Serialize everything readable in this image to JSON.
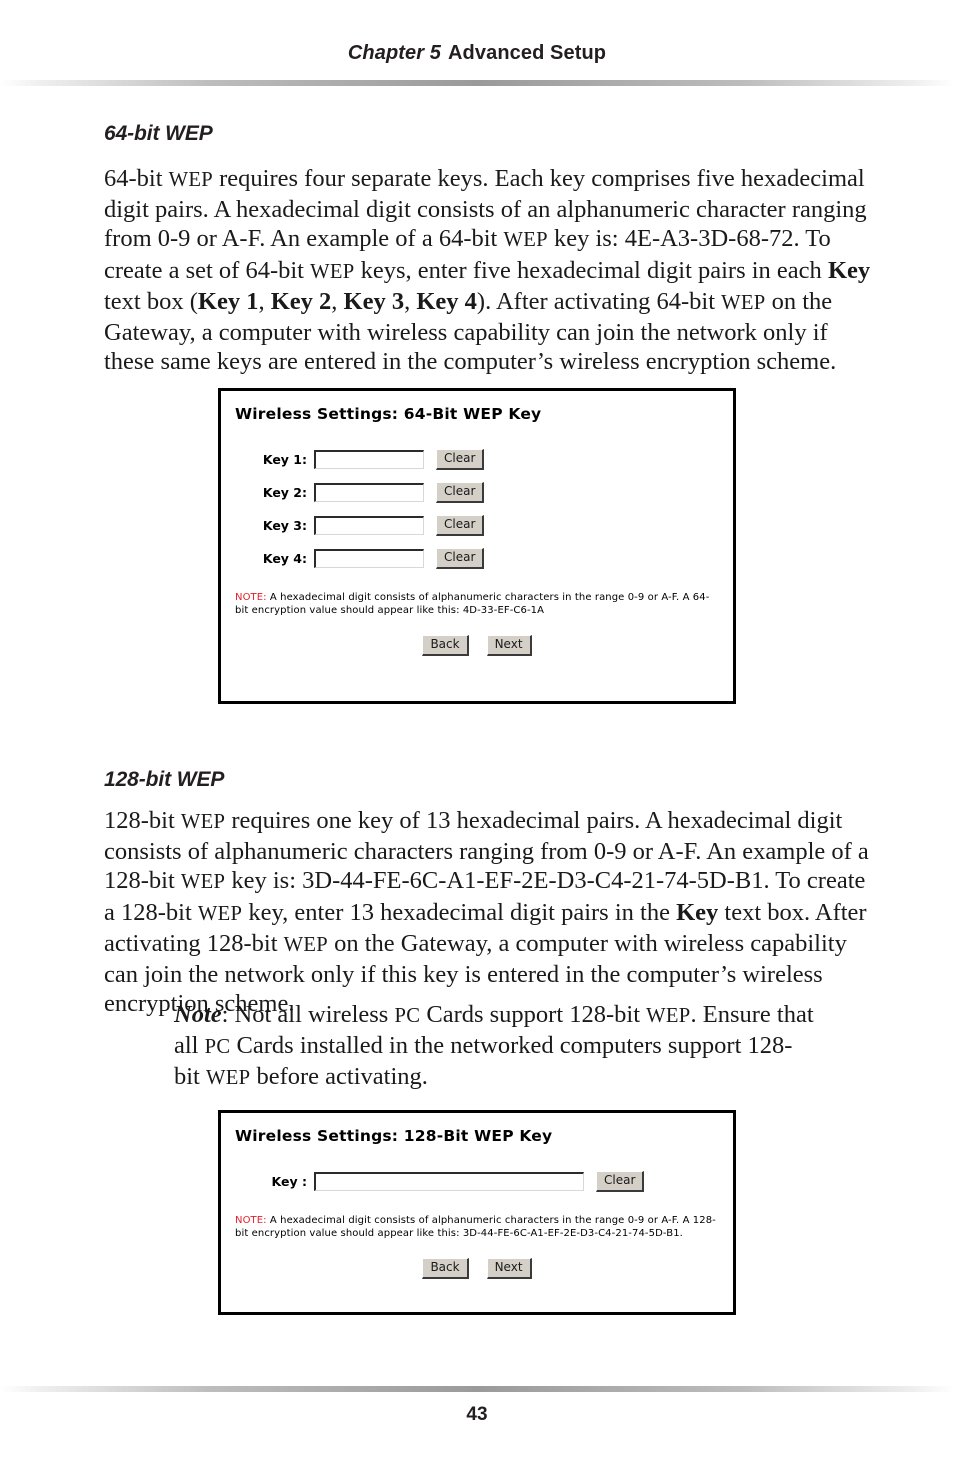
{
  "page": {
    "running_head_chapter": "Chapter 5",
    "running_head_title": "Advanced Setup",
    "folio": "43"
  },
  "sections": {
    "wep64": {
      "heading": "64-bit WEP",
      "paragraph_html": "64-bit <span class=\"sc\">WEP</span> requires four separate keys. Each key comprises five hexadecimal digit pairs. A hexadecimal digit consists of an alphanumeric character ranging from 0-9 or A-F. An example of a 64-bit <span class=\"sc\">WEP</span> key is: 4E-A3-3D-68-72. To create a set of 64-bit <span class=\"sc\">WEP</span> keys, enter five hexadecimal digit pairs in each <b>Key</b> text box (<b>Key 1</b>, <b>Key 2</b>, <b>Key 3</b>, <b>Key 4</b>). After activating 64-bit <span class=\"sc\">WEP</span> on the Gateway, a computer with wireless capability can join the network only if these same keys are entered in the computer’s wireless encryption scheme."
    },
    "wep128": {
      "heading": "128-bit WEP",
      "paragraph_html": "128-bit <span class=\"sc\">WEP</span> requires one key of 13 hexadecimal pairs. A hexadecimal digit consists of alphanumeric characters ranging from 0-9 or A-F. An example of a 128-bit <span class=\"sc\">WEP</span> key is: 3D-44-FE-6C-A1-EF-2E-D3-C4-21-74-5D-B1. To create a 128-bit <span class=\"sc\">WEP</span> key, enter 13 hexadecimal digit pairs in the <b>Key</b> text box. After activating 128-bit <span class=\"sc\">WEP</span> on the Gateway, a computer with wireless capability can join the network only if this key is entered in the computer’s wireless encryption scheme.",
      "note_html": "<span class=\"note-lead\">Note</span>: Not all wireless <span class=\"sc\">PC</span> Cards support 128-bit <span class=\"sc\">WEP</span>. Ensure that all <span class=\"sc\">PC</span> Cards installed in the networked computers support 128-bit <span class=\"sc\">WEP</span> before activating."
    }
  },
  "figure_64bit": {
    "title": "Wireless Settings: 64-Bit WEP Key",
    "rows": [
      {
        "label": "Key 1:",
        "value": "",
        "clear_label": "Clear"
      },
      {
        "label": "Key 2:",
        "value": "",
        "clear_label": "Clear"
      },
      {
        "label": "Key 3:",
        "value": "",
        "clear_label": "Clear"
      },
      {
        "label": "Key 4:",
        "value": "",
        "clear_label": "Clear"
      }
    ],
    "note_tag": "NOTE:",
    "note_text": " A hexadecimal digit consists of alphanumeric characters in the range 0-9 or A-F. A 64-bit encryption value should appear like this: 4D-33-EF-C6-1A",
    "back_label": "Back",
    "next_label": "Next"
  },
  "figure_128bit": {
    "title": "Wireless Settings: 128-Bit WEP Key",
    "row": {
      "label": "Key :",
      "value": "",
      "clear_label": "Clear"
    },
    "note_tag": "NOTE:",
    "note_text": " A hexadecimal digit consists of alphanumeric characters in the range 0-9 or A-F. A 128-bit encryption value should appear like this: 3D-44-FE-6C-A1-EF-2E-D3-C4-21-74-5D-B1.",
    "back_label": "Back",
    "next_label": "Next"
  },
  "colors": {
    "note_red": "#e3202a",
    "button_face": "#d4d0c8",
    "text": "#1a1a1a"
  }
}
